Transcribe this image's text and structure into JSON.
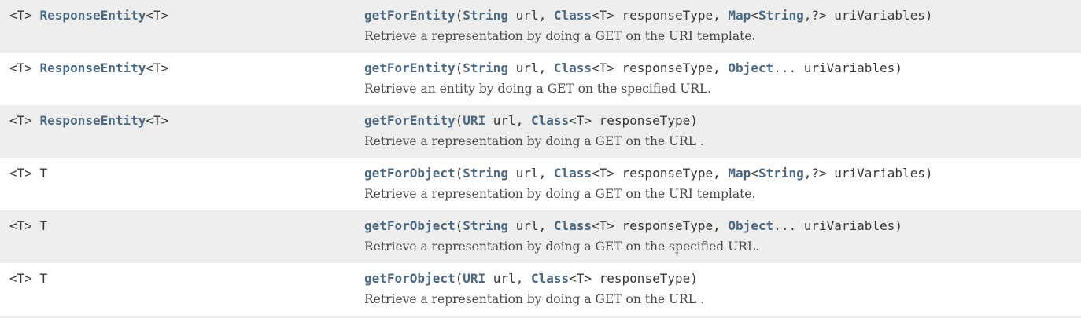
{
  "rows": [
    {
      "type_prefix": "<T> ",
      "type_link": "ResponseEntity",
      "type_suffix": "<T>",
      "method": "getForEntity",
      "sig_parts": [
        {
          "t": "(",
          "link": false
        },
        {
          "t": "String",
          "link": true
        },
        {
          "t": " url, ",
          "link": false
        },
        {
          "t": "Class",
          "link": true
        },
        {
          "t": "<T> responseType, ",
          "link": false
        },
        {
          "t": "Map",
          "link": true
        },
        {
          "t": "<",
          "link": false
        },
        {
          "t": "String",
          "link": true
        },
        {
          "t": ",?> uriVariables)",
          "link": false
        }
      ],
      "description": "Retrieve a representation by doing a GET on the URI template."
    },
    {
      "type_prefix": "<T> ",
      "type_link": "ResponseEntity",
      "type_suffix": "<T>",
      "method": "getForEntity",
      "sig_parts": [
        {
          "t": "(",
          "link": false
        },
        {
          "t": "String",
          "link": true
        },
        {
          "t": " url, ",
          "link": false
        },
        {
          "t": "Class",
          "link": true
        },
        {
          "t": "<T> responseType, ",
          "link": false
        },
        {
          "t": "Object",
          "link": true
        },
        {
          "t": "... uriVariables)",
          "link": false
        }
      ],
      "description": "Retrieve an entity by doing a GET on the specified URL."
    },
    {
      "type_prefix": "<T> ",
      "type_link": "ResponseEntity",
      "type_suffix": "<T>",
      "method": "getForEntity",
      "sig_parts": [
        {
          "t": "(",
          "link": false
        },
        {
          "t": "URI",
          "link": true
        },
        {
          "t": " url, ",
          "link": false
        },
        {
          "t": "Class",
          "link": true
        },
        {
          "t": "<T> responseType)",
          "link": false
        }
      ],
      "description": "Retrieve a representation by doing a GET on the URL ."
    },
    {
      "type_prefix": "<T> T",
      "type_link": "",
      "type_suffix": "",
      "method": "getForObject",
      "sig_parts": [
        {
          "t": "(",
          "link": false
        },
        {
          "t": "String",
          "link": true
        },
        {
          "t": " url, ",
          "link": false
        },
        {
          "t": "Class",
          "link": true
        },
        {
          "t": "<T> responseType, ",
          "link": false
        },
        {
          "t": "Map",
          "link": true
        },
        {
          "t": "<",
          "link": false
        },
        {
          "t": "String",
          "link": true
        },
        {
          "t": ",?> uriVariables)",
          "link": false
        }
      ],
      "description": "Retrieve a representation by doing a GET on the URI template."
    },
    {
      "type_prefix": "<T> T",
      "type_link": "",
      "type_suffix": "",
      "method": "getForObject",
      "sig_parts": [
        {
          "t": "(",
          "link": false
        },
        {
          "t": "String",
          "link": true
        },
        {
          "t": " url, ",
          "link": false
        },
        {
          "t": "Class",
          "link": true
        },
        {
          "t": "<T> responseType, ",
          "link": false
        },
        {
          "t": "Object",
          "link": true
        },
        {
          "t": "... uriVariables)",
          "link": false
        }
      ],
      "description": "Retrieve a representation by doing a GET on the specified URL."
    },
    {
      "type_prefix": "<T> T",
      "type_link": "",
      "type_suffix": "",
      "method": "getForObject",
      "sig_parts": [
        {
          "t": "(",
          "link": false
        },
        {
          "t": "URI",
          "link": true
        },
        {
          "t": " url, ",
          "link": false
        },
        {
          "t": "Class",
          "link": true
        },
        {
          "t": "<T> responseType)",
          "link": false
        }
      ],
      "description": "Retrieve a representation by doing a GET on the URL ."
    }
  ],
  "colors": {
    "link": "#4a6782",
    "text": "#353833",
    "alt_row": "#eeeeee"
  }
}
